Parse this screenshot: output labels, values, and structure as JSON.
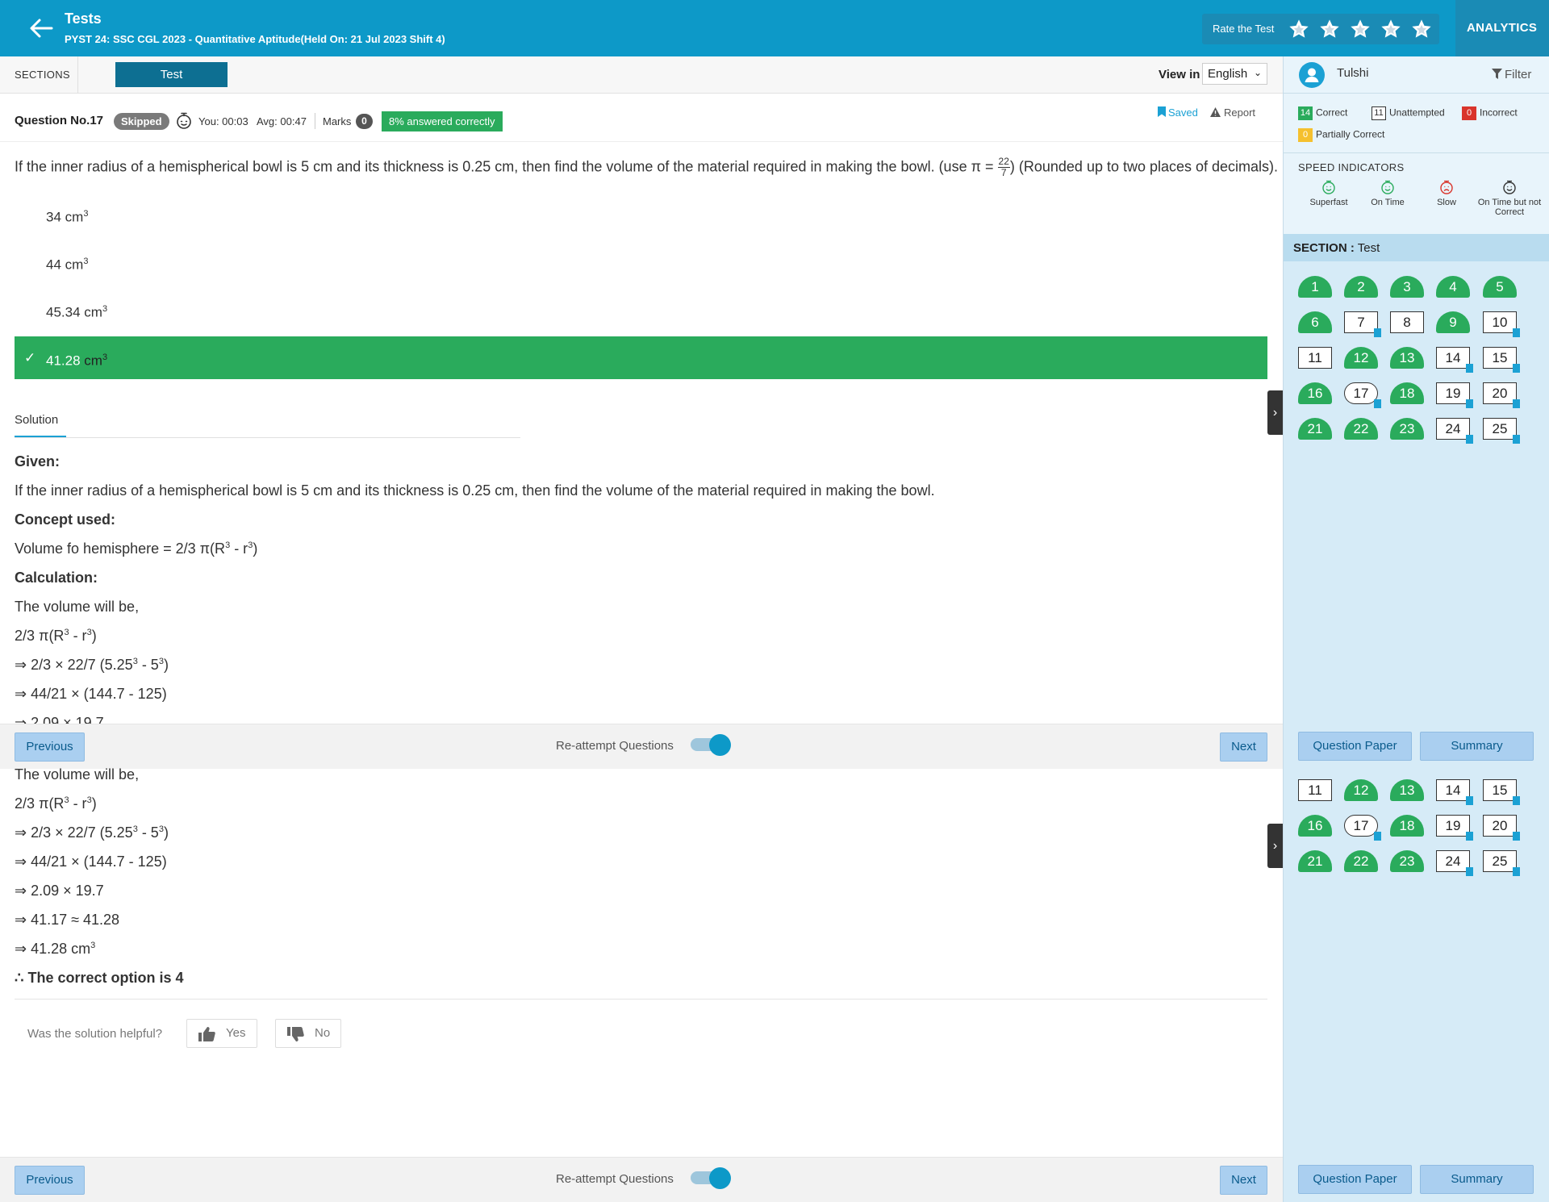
{
  "header": {
    "app_title": "Tests",
    "test_name": "PYST 24: SSC CGL 2023 - Quantitative Aptitude(Held On: 21 Jul 2023 Shift 4)",
    "rate_label": "Rate the Test",
    "analytics_label": "ANALYTICS"
  },
  "sections_bar": {
    "label": "SECTIONS",
    "active_tab": "Test",
    "view_in_label": "View in",
    "language": "English"
  },
  "question_info": {
    "number_label": "Question No.17",
    "status": "Skipped",
    "you_time": "You: 00:03",
    "avg_time": "Avg: 00:47",
    "marks_label": "Marks",
    "marks_value": "0",
    "percent_correct": "8% answered correctly",
    "saved_label": "Saved",
    "report_label": "Report"
  },
  "question": {
    "text_before": "If the inner radius of a hemispherical bowl is 5 cm and its thickness is 0.25 cm, then find the volume of the material required in making the bowl. (use π =",
    "frac_num": "22",
    "frac_den": "7",
    "text_after": ") (Rounded up to two places of decimals).",
    "options": [
      {
        "value": "34",
        "unit": "cm",
        "sup": "3",
        "correct": false
      },
      {
        "value": "44",
        "unit": "cm",
        "sup": "3",
        "correct": false
      },
      {
        "value": "45.34",
        "unit": "cm",
        "sup": "3",
        "correct": false
      },
      {
        "value": "41.28",
        "unit": "cm",
        "sup": "3",
        "correct": true
      }
    ]
  },
  "solution": {
    "tab_label": "Solution",
    "given_label": "Given:",
    "given_text": "If the inner radius of a hemispherical bowl is 5 cm and its thickness is 0.25 cm, then find the volume of the material required in making the bowl.",
    "concept_label": "Concept used:",
    "concept_text_a": "Volume fo hemisphere = 2/3 π(R",
    "concept_text_b": " - r",
    "concept_text_c": ")",
    "calc_label": "Calculation:",
    "volume_line": "The volume will be,",
    "formula_a": "2/3 π(R",
    "formula_b": " - r",
    "formula_c": ")",
    "step1_a": "⇒ 2/3 × 22/7 (5.25",
    "step1_b": " - 5",
    "step1_c": ")",
    "step2": "⇒ 44/21 × (144.7 - 125)",
    "step3": "⇒ 2.09 × 19.7",
    "step4": "⇒ 41.17 ≈ 41.28",
    "step5_a": "⇒ 41.28 cm",
    "sup3": "3",
    "conclusion": "∴ The correct option is 4"
  },
  "footer": {
    "previous_label": "Previous",
    "reattempt_label": "Re-attempt Questions",
    "next_label": "Next",
    "question_paper_label": "Question Paper",
    "summary_label": "Summary"
  },
  "feedback": {
    "prompt": "Was the solution helpful?",
    "yes_label": "Yes",
    "no_label": "No"
  },
  "right_panel": {
    "user_name": "Tulshi",
    "filter_label": "Filter",
    "legend": {
      "correct_count": "14",
      "correct_label": "Correct",
      "unattempted_count": "11",
      "unattempted_label": "Unattempted",
      "incorrect_count": "0",
      "incorrect_label": "Incorrect",
      "partial_count": "0",
      "partial_label": "Partially Correct"
    },
    "speed_title": "SPEED INDICATORS",
    "speed": [
      "Superfast",
      "On Time",
      "Slow",
      "On Time but not Correct"
    ],
    "section_label": "SECTION :",
    "section_name": "Test",
    "palette": [
      {
        "n": "1",
        "s": "ans"
      },
      {
        "n": "2",
        "s": "ans"
      },
      {
        "n": "3",
        "s": "ans"
      },
      {
        "n": "4",
        "s": "ans"
      },
      {
        "n": "5",
        "s": "ans"
      },
      {
        "n": "6",
        "s": "ans"
      },
      {
        "n": "7",
        "s": "un",
        "bm": true
      },
      {
        "n": "8",
        "s": "un"
      },
      {
        "n": "9",
        "s": "ans"
      },
      {
        "n": "10",
        "s": "un",
        "bm": true
      },
      {
        "n": "11",
        "s": "un"
      },
      {
        "n": "12",
        "s": "ans"
      },
      {
        "n": "13",
        "s": "ans"
      },
      {
        "n": "14",
        "s": "un",
        "bm": true
      },
      {
        "n": "15",
        "s": "un",
        "bm": true
      },
      {
        "n": "16",
        "s": "ans"
      },
      {
        "n": "17",
        "s": "cur",
        "bm": true
      },
      {
        "n": "18",
        "s": "ans"
      },
      {
        "n": "19",
        "s": "un",
        "bm": true
      },
      {
        "n": "20",
        "s": "un",
        "bm": true
      },
      {
        "n": "21",
        "s": "ans"
      },
      {
        "n": "22",
        "s": "ans"
      },
      {
        "n": "23",
        "s": "ans"
      },
      {
        "n": "24",
        "s": "un",
        "bm": true
      },
      {
        "n": "25",
        "s": "un",
        "bm": true
      }
    ]
  },
  "colors": {
    "header_blue": "#0d99c8",
    "correct_green": "#2aab5c",
    "panel_bg": "#d6ebf7",
    "incorrect_red": "#d9342b",
    "partial_yellow": "#f5c02e"
  }
}
